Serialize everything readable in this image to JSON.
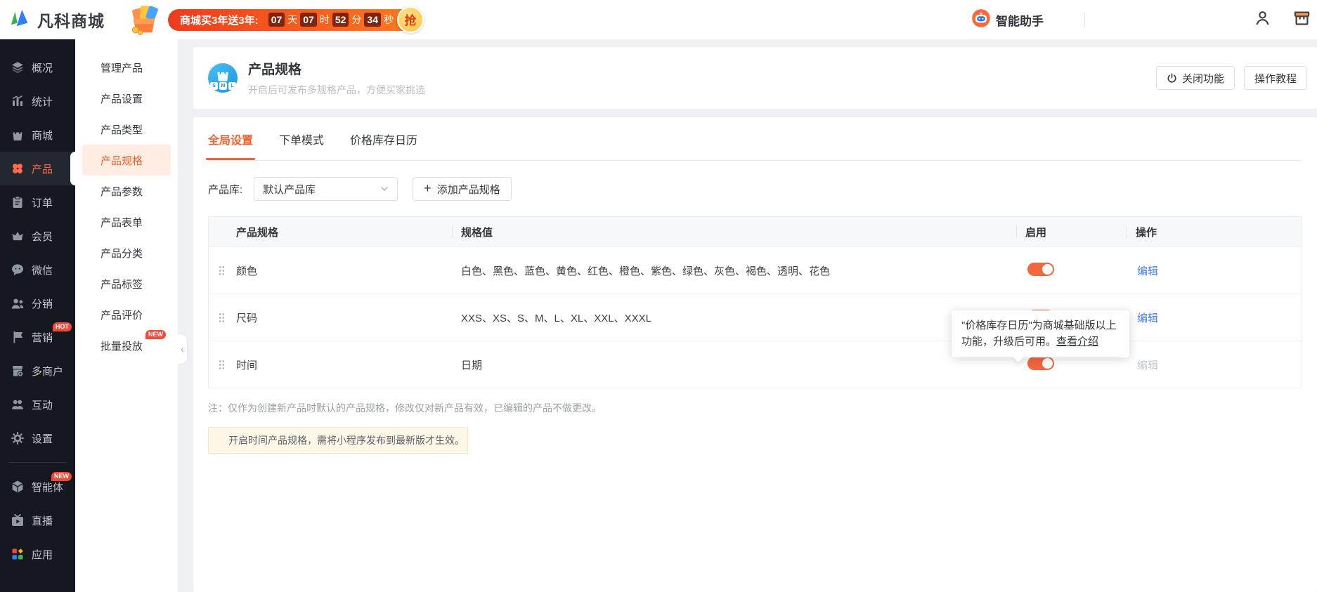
{
  "topbar": {
    "logo_text": "凡科商城",
    "promo": {
      "label": "商城买3年送3年:",
      "countdown": [
        {
          "value": "07",
          "unit": "天"
        },
        {
          "value": "07",
          "unit": "时"
        },
        {
          "value": "52",
          "unit": "分"
        },
        {
          "value": "34",
          "unit": "秒"
        }
      ],
      "grab_label": "抢"
    },
    "assistant_label": "智能助手"
  },
  "sidebar": {
    "active": "产品",
    "items": [
      {
        "id": "overview",
        "label": "概况",
        "icon": "layers"
      },
      {
        "id": "stats",
        "label": "统计",
        "icon": "chart"
      },
      {
        "id": "mall",
        "label": "商城",
        "icon": "bag"
      },
      {
        "id": "product",
        "label": "产品",
        "icon": "clover"
      },
      {
        "id": "orders",
        "label": "订单",
        "icon": "clipboard"
      },
      {
        "id": "members",
        "label": "会员",
        "icon": "crown"
      },
      {
        "id": "wechat",
        "label": "微信",
        "icon": "wechat"
      },
      {
        "id": "distribution",
        "label": "分销",
        "icon": "person-group"
      },
      {
        "id": "marketing",
        "label": "营销",
        "icon": "flag",
        "badge": "HOT"
      },
      {
        "id": "multi-merchant",
        "label": "多商户",
        "icon": "store"
      },
      {
        "id": "interaction",
        "label": "互动",
        "icon": "people"
      },
      {
        "id": "settings",
        "label": "设置",
        "icon": "gear"
      },
      {
        "id": "ai-agent",
        "label": "智能体",
        "icon": "cube",
        "badge": "NEW",
        "divider_before": true
      },
      {
        "id": "live",
        "label": "直播",
        "icon": "tv"
      },
      {
        "id": "apps",
        "label": "应用",
        "icon": "apps"
      }
    ]
  },
  "submenu": {
    "active": "产品规格",
    "items": [
      {
        "label": "管理产品"
      },
      {
        "label": "产品设置"
      },
      {
        "label": "产品类型"
      },
      {
        "label": "产品规格"
      },
      {
        "label": "产品参数"
      },
      {
        "label": "产品表单"
      },
      {
        "label": "产品分类"
      },
      {
        "label": "产品标签"
      },
      {
        "label": "产品评价"
      },
      {
        "label": "批量投放",
        "badge": "NEW"
      }
    ]
  },
  "page_header": {
    "title": "产品规格",
    "subtitle": "开启后可发布多规格产品，方便买家挑选",
    "icon_letters": [
      "S",
      "M",
      "L"
    ],
    "close_button": "关闭功能",
    "tutorial_button": "操作教程"
  },
  "tabs": {
    "active": "全局设置",
    "items": [
      "全局设置",
      "下单模式",
      "价格库存日历"
    ]
  },
  "filter": {
    "label": "产品库:",
    "dropdown_value": "默认产品库",
    "add_button": "添加产品规格"
  },
  "spec_table": {
    "columns": [
      "产品规格",
      "规格值",
      "启用",
      "操作"
    ],
    "rows": [
      {
        "name": "颜色",
        "values": "白色、黑色、蓝色、黄色、红色、橙色、紫色、绿色、灰色、褐色、透明、花色",
        "enabled": true,
        "action": "编辑",
        "action_disabled": false
      },
      {
        "name": "尺码",
        "values": "XXS、XS、S、M、L、XL、XXL、XXXL",
        "enabled": true,
        "action": "编辑",
        "action_disabled": false
      },
      {
        "name": "时间",
        "values": "日期",
        "enabled": true,
        "action": "编辑",
        "action_disabled": true
      }
    ]
  },
  "tooltip": {
    "text": "\"价格库存日历\"为商城基础版以上功能，升级后可用。",
    "link": "查看介绍"
  },
  "note": "注：仅作为创建新产品时默认的产品规格，修改仅对新产品有效，已编辑的产品不做更改。",
  "notice": "开启时间产品规格，需将小程序发布到最新版才生效。",
  "colors": {
    "accent": "#f3632e",
    "toggle_on": "#f4663c",
    "link": "#4a7df5",
    "badge": "#f5483b",
    "sidebar_bg": "#15181e"
  }
}
